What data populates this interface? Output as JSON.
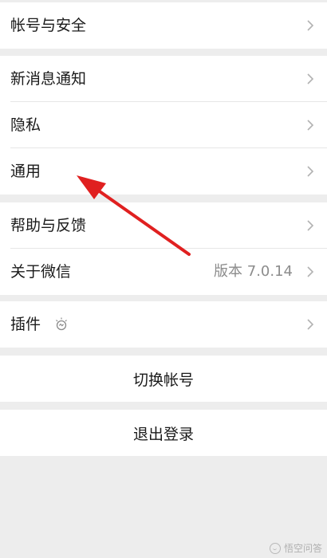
{
  "account_group": {
    "items": [
      {
        "label": "帐号与安全"
      }
    ]
  },
  "settings_group": {
    "items": [
      {
        "label": "新消息通知"
      },
      {
        "label": "隐私"
      },
      {
        "label": "通用"
      }
    ]
  },
  "about_group": {
    "items": [
      {
        "label": "帮助与反馈"
      },
      {
        "label": "关于微信",
        "value": "版本 7.0.14"
      }
    ]
  },
  "plugin_group": {
    "items": [
      {
        "label": "插件",
        "icon": "plugin-bulb-icon"
      }
    ]
  },
  "actions": {
    "switch_account": "切换帐号",
    "logout": "退出登录"
  },
  "watermark": {
    "text": "悟空问答"
  },
  "colors": {
    "background": "#ededed",
    "row_background": "#ffffff",
    "text": "#1a1a1a",
    "secondary_text": "#8c8c8c",
    "chevron": "#b2b2b2",
    "annotation_arrow": "#e02020"
  }
}
